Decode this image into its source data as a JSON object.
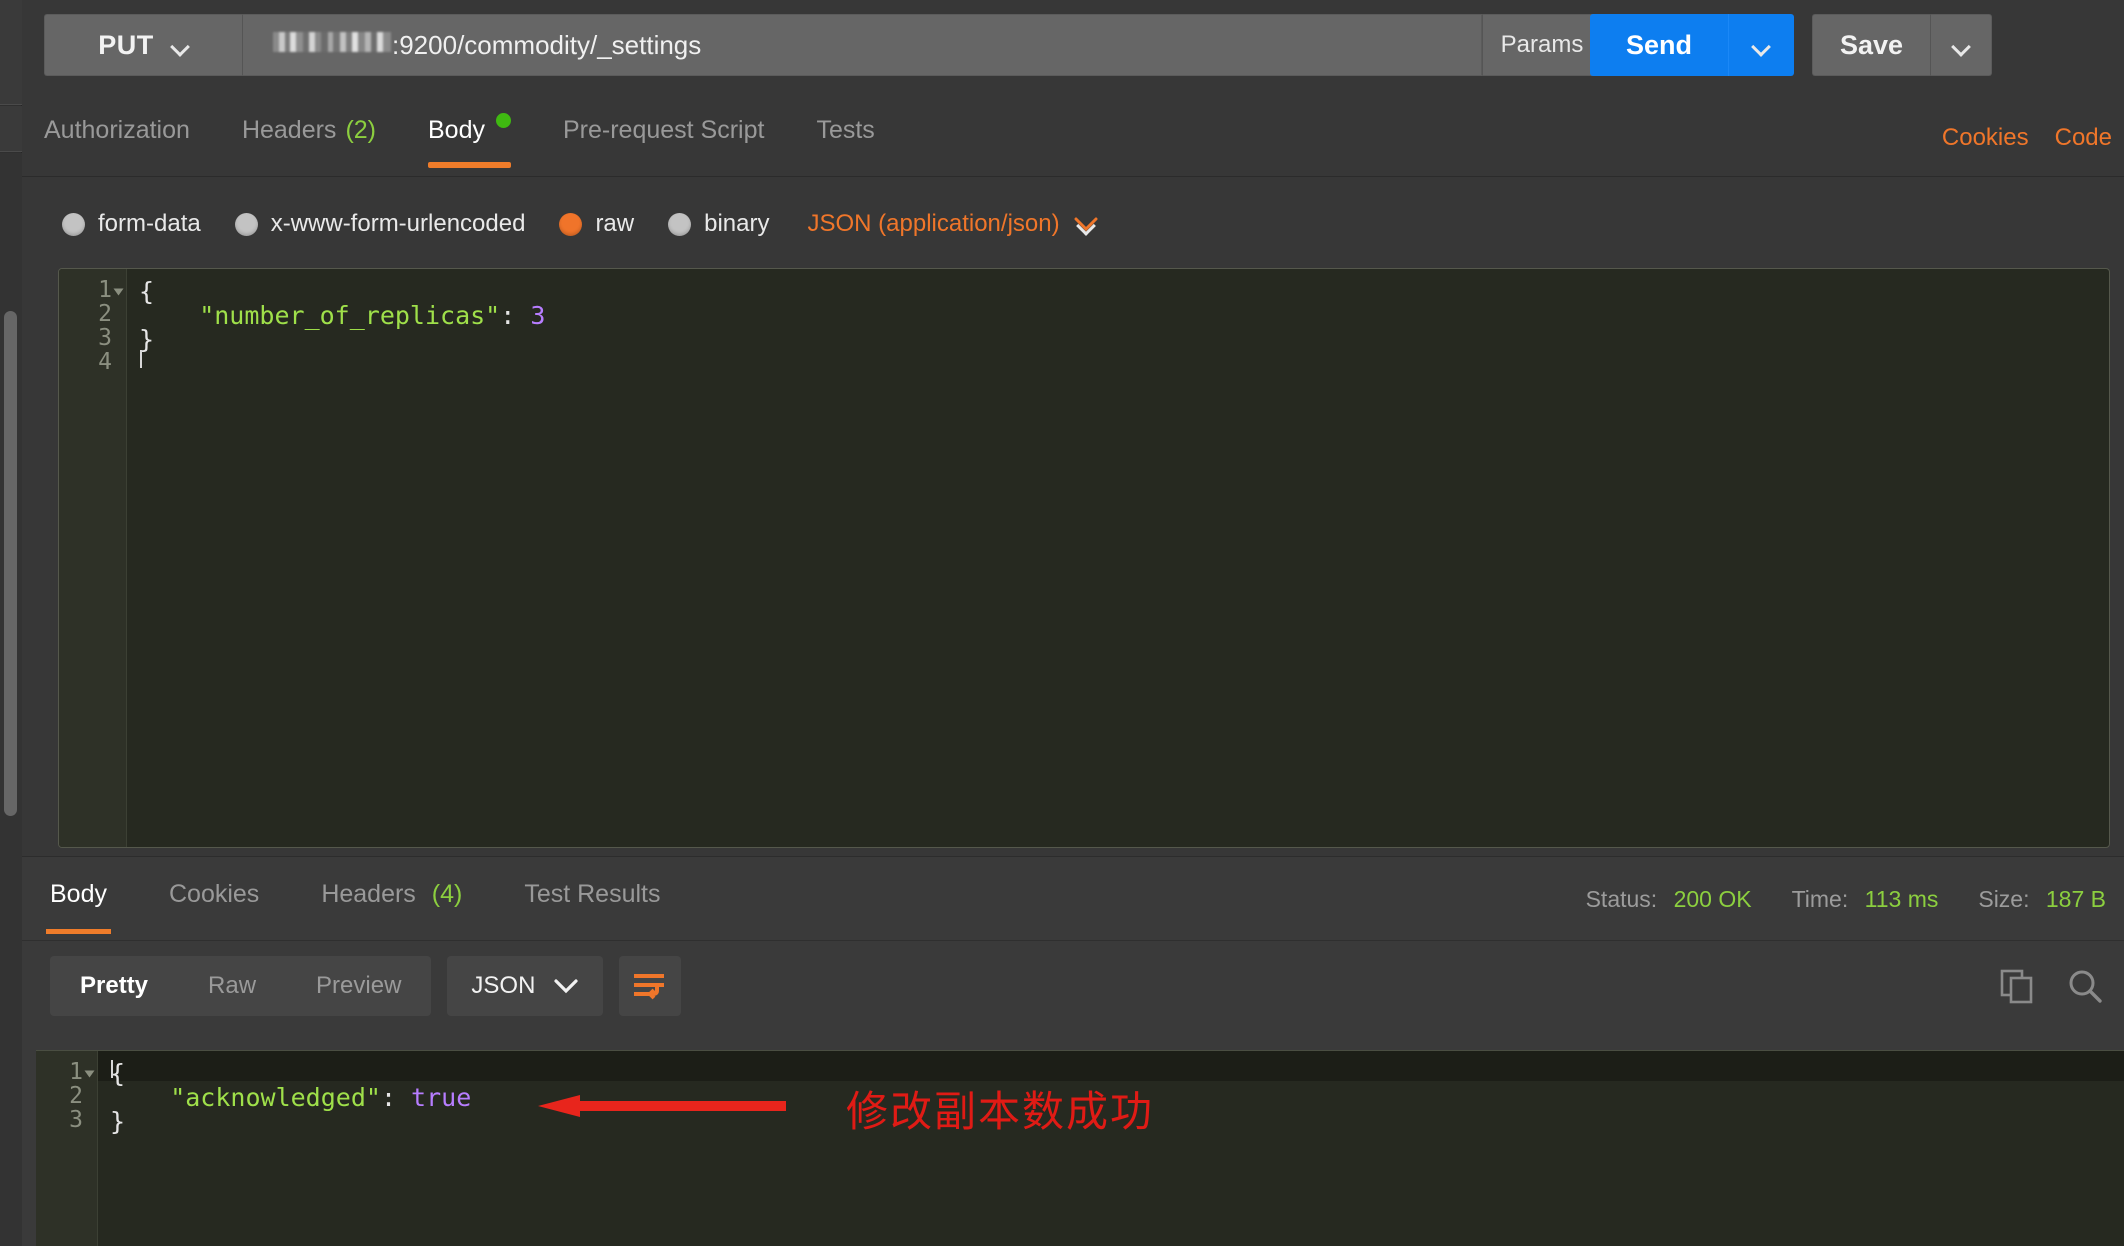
{
  "request": {
    "method": "PUT",
    "url_visible_suffix": ":9200/commodity/_settings",
    "url_redacted_note": "host-ip-mosaic-blurred",
    "params_label": "Params",
    "send_label": "Send",
    "save_label": "Save",
    "tabs": [
      {
        "label": "Authorization",
        "active": false
      },
      {
        "label": "Headers",
        "count": "(2)",
        "active": false
      },
      {
        "label": "Body",
        "active": true,
        "has_dot": true
      },
      {
        "label": "Pre-request Script",
        "active": false
      },
      {
        "label": "Tests",
        "active": false
      }
    ],
    "links": [
      {
        "label": "Cookies"
      },
      {
        "label": "Code"
      }
    ],
    "body_types": [
      {
        "label": "form-data",
        "selected": false
      },
      {
        "label": "x-www-form-urlencoded",
        "selected": false
      },
      {
        "label": "raw",
        "selected": true
      },
      {
        "label": "binary",
        "selected": false
      }
    ],
    "content_type": "JSON (application/json)",
    "editor": {
      "lines": [
        {
          "num": "1",
          "fold": true,
          "tokens": [
            {
              "t": "{",
              "c": "punc"
            }
          ]
        },
        {
          "num": "2",
          "fold": false,
          "tokens": [
            {
              "t": "    \"number_of_replicas\"",
              "c": "key"
            },
            {
              "t": ": ",
              "c": "punc"
            },
            {
              "t": "3",
              "c": "num"
            }
          ]
        },
        {
          "num": "3",
          "fold": false,
          "tokens": [
            {
              "t": "}",
              "c": "punc"
            }
          ]
        },
        {
          "num": "4",
          "fold": false,
          "tokens": []
        }
      ],
      "active_line": 4
    }
  },
  "response": {
    "tabs": [
      {
        "label": "Body",
        "active": true
      },
      {
        "label": "Cookies",
        "active": false
      },
      {
        "label": "Headers",
        "count": "(4)",
        "active": false
      },
      {
        "label": "Test Results",
        "active": false
      }
    ],
    "meta": [
      {
        "key": "Status:",
        "value": "200 OK"
      },
      {
        "key": "Time:",
        "value": "113 ms"
      },
      {
        "key": "Size:",
        "value": "187 B"
      }
    ],
    "view_modes": [
      {
        "label": "Pretty",
        "active": true
      },
      {
        "label": "Raw",
        "active": false
      },
      {
        "label": "Preview",
        "active": false
      }
    ],
    "format": "JSON",
    "icons": {
      "wrap": "word-wrap-icon",
      "copy": "copy-icon",
      "search": "search-icon"
    },
    "editor": {
      "lines": [
        {
          "num": "1",
          "fold": true,
          "tokens": [
            {
              "t": "{",
              "c": "punc"
            }
          ]
        },
        {
          "num": "2",
          "fold": false,
          "tokens": [
            {
              "t": "    \"acknowledged\"",
              "c": "key"
            },
            {
              "t": ": ",
              "c": "punc"
            },
            {
              "t": "true",
              "c": "bool"
            }
          ]
        },
        {
          "num": "3",
          "fold": false,
          "tokens": [
            {
              "t": "}",
              "c": "punc"
            }
          ]
        }
      ],
      "active_line": 1
    }
  },
  "annotation": {
    "text": "修改副本数成功",
    "color": "#e01b15",
    "arrow_direction": "left"
  },
  "colors": {
    "accent_orange": "#ef7c2a",
    "send_blue": "#0d7ef0",
    "status_green": "#8ccf3f",
    "string_green": "#9fe04a",
    "value_purple": "#b77dff",
    "annotation_red": "#e01b15"
  }
}
